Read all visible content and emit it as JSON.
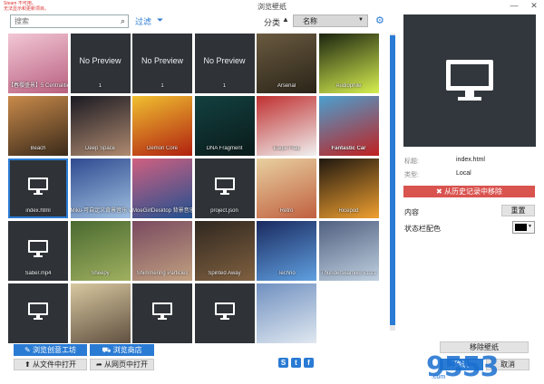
{
  "window": {
    "title": "浏览壁纸",
    "warning_line1": "Steam 不可用。",
    "warning_line2": "无法显示和更新项目。"
  },
  "search": {
    "placeholder": "搜索"
  },
  "filter": {
    "label": "过滤"
  },
  "sort": {
    "label": "分类",
    "value": "名称"
  },
  "tiles": [
    {
      "label": "【春樱盛景】5 Centralities PeriScope",
      "no_preview": "",
      "type": "image"
    },
    {
      "label": "1",
      "no_preview": "No Preview",
      "type": "nopreview"
    },
    {
      "label": "1",
      "no_preview": "No Preview",
      "type": "nopreview"
    },
    {
      "label": "1",
      "no_preview": "No Preview",
      "type": "nopreview"
    },
    {
      "label": "Arsenal",
      "no_preview": "",
      "type": "image"
    },
    {
      "label": "Audiophile",
      "no_preview": "",
      "type": "image"
    },
    {
      "label": "Beach",
      "no_preview": "",
      "type": "image"
    },
    {
      "label": "Deep Space",
      "no_preview": "",
      "type": "image"
    },
    {
      "label": "Demon Core",
      "no_preview": "",
      "type": "image"
    },
    {
      "label": "DNA Fragment",
      "no_preview": "",
      "type": "image"
    },
    {
      "label": "Eagle Flag",
      "no_preview": "",
      "type": "image"
    },
    {
      "label": "Fantastic Car",
      "no_preview": "",
      "type": "image"
    },
    {
      "label": "index.html",
      "no_preview": "",
      "type": "monitor"
    },
    {
      "label": "Miku-可自定义背景音乐 v1.22",
      "no_preview": "",
      "type": "image"
    },
    {
      "label": "MoeGirlDesktop 背景音乐 v1.22",
      "no_preview": "",
      "type": "image"
    },
    {
      "label": "project.json",
      "no_preview": "",
      "type": "monitor"
    },
    {
      "label": "Retro",
      "no_preview": "",
      "type": "image"
    },
    {
      "label": "Ricepod",
      "no_preview": "",
      "type": "image"
    },
    {
      "label": "Saber.mp4",
      "no_preview": "",
      "type": "monitor"
    },
    {
      "label": "Sheepy",
      "no_preview": "",
      "type": "image"
    },
    {
      "label": "Shimmering Particles",
      "no_preview": "",
      "type": "image"
    },
    {
      "label": "Spirited Away",
      "no_preview": "",
      "type": "image"
    },
    {
      "label": "Techno",
      "no_preview": "",
      "type": "image"
    },
    {
      "label": "Thunderseamiku v1.21",
      "no_preview": "",
      "type": "image"
    },
    {
      "label": "",
      "no_preview": "",
      "type": "monitor"
    },
    {
      "label": "",
      "no_preview": "",
      "type": "image"
    },
    {
      "label": "",
      "no_preview": "",
      "type": "monitor"
    },
    {
      "label": "",
      "no_preview": "",
      "type": "monitor"
    },
    {
      "label": "",
      "no_preview": "",
      "type": "image"
    }
  ],
  "details": {
    "title_label": "标题:",
    "title_value": "index.html",
    "type_label": "类型:",
    "type_value": "Local",
    "remove_history": "从历史记录中移除",
    "content_label": "内容",
    "reset_button": "重置",
    "statusbar_color_label": "状态栏配色",
    "statusbar_color": "#000000"
  },
  "buttons": {
    "browse_workshop": "浏览创意工坊",
    "browse_store": "浏览商店",
    "open_file": "从文件中打开",
    "open_web": "从网页中打开",
    "remove_wallpaper": "移除壁纸",
    "ok": "确认",
    "cancel": "取消"
  },
  "watermark": {
    "text": "9553",
    "sub": ".com"
  },
  "colors": {
    "accent": "#2a7bd4",
    "danger": "#d9534f",
    "tile_dark": "#2f3338"
  }
}
